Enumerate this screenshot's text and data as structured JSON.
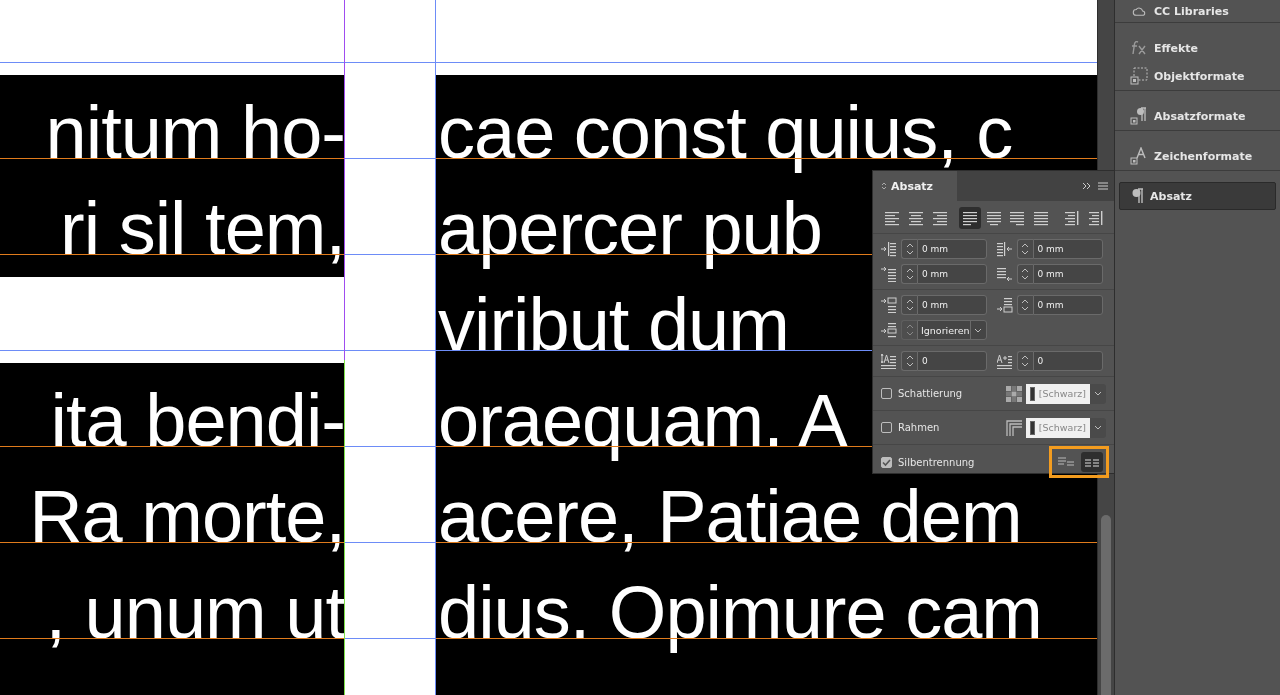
{
  "canvas": {
    "left_column": {
      "blocks": [
        {
          "lines": [
            "nitum ho-",
            "ri sil tem,"
          ]
        },
        {
          "lines": [
            "ita bendi-",
            "Ra morte,",
            ", unum ut"
          ]
        }
      ]
    },
    "right_column": {
      "lines": [
        "cae const quius, c",
        "apercer pub",
        "viribut dum",
        "oraequam. A",
        "acere, Patiae dem",
        "dius. Opimure cam"
      ]
    }
  },
  "dock": {
    "items": [
      {
        "label": "CC Libraries",
        "kind": "cc",
        "selected": false
      },
      {
        "label": "Effekte",
        "kind": "fx",
        "selected": false
      },
      {
        "label": "Objektformate",
        "kind": "object",
        "selected": false
      },
      {
        "label": "Absatzformate",
        "kind": "pilcrow_style",
        "selected": false
      },
      {
        "label": "Zeichenformate",
        "kind": "char_style",
        "selected": false
      },
      {
        "label": "Absatz",
        "kind": "pilcrow",
        "selected": true
      }
    ]
  },
  "paragraph_panel": {
    "tab": "Absatz",
    "alignment_buttons": [
      {
        "kind": "left",
        "selected": false
      },
      {
        "kind": "center",
        "selected": false
      },
      {
        "kind": "right",
        "selected": false
      },
      {
        "kind": "justify_left",
        "selected": true
      },
      {
        "kind": "justify_center",
        "selected": false
      },
      {
        "kind": "justify_right",
        "selected": false
      },
      {
        "kind": "justify_all",
        "selected": false
      },
      {
        "kind": "toward_spine",
        "selected": false
      },
      {
        "kind": "away_from_spine",
        "selected": false
      }
    ],
    "field_groups": [
      [
        {
          "kind": "left_indent",
          "value": "0 mm"
        },
        {
          "kind": "right_indent",
          "value": "0 mm"
        },
        {
          "kind": "first_line",
          "value": "0 mm"
        },
        {
          "kind": "last_line",
          "value": "0 mm"
        }
      ],
      [
        {
          "kind": "space_before",
          "value": "0 mm"
        },
        {
          "kind": "space_after",
          "value": "0 mm"
        }
      ]
    ],
    "grid_alignment": {
      "value": "Ignorieren"
    },
    "drop_cap_fields": [
      {
        "kind": "drop_lines",
        "value": "0"
      },
      {
        "kind": "drop_chars",
        "value": "0"
      }
    ],
    "shading": {
      "label": "Schattierung",
      "checked": false,
      "swatch": "[Schwarz]"
    },
    "border": {
      "label": "Rahmen",
      "checked": false,
      "swatch": "[Schwarz]"
    },
    "hyphenation": {
      "label": "Silbentrennung",
      "checked": true
    },
    "composer_highlighted": true,
    "composer_buttons": [
      {
        "kind": "single_line",
        "selected": false
      },
      {
        "kind": "paragraph",
        "selected": true
      }
    ]
  }
}
